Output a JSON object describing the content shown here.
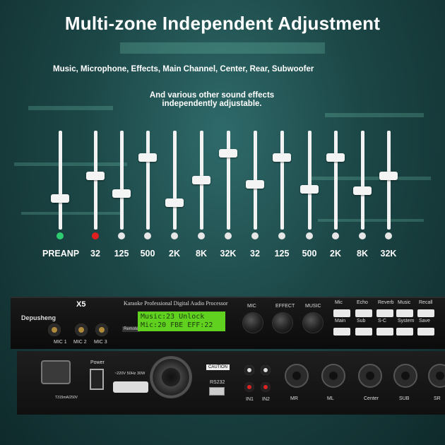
{
  "headline": "Multi-zone Independent Adjustment",
  "subtitle_line1": "Music, Microphone, Effects, Main Channel, Center, Rear, Subwoofer",
  "subtitle_line2a": "And various other sound effects",
  "subtitle_line2b": "independently adjustable.",
  "eq": {
    "bands": [
      "PREANP",
      "32",
      "125",
      "500",
      "2K",
      "8K",
      "32K",
      "32",
      "125",
      "500",
      "2K",
      "8K",
      "32K"
    ],
    "levels": [
      0.3,
      0.55,
      0.35,
      0.75,
      0.25,
      0.5,
      0.8,
      0.45,
      0.75,
      0.4,
      0.75,
      0.38,
      0.55
    ],
    "dot_colors": [
      "#2ecc71",
      "#e02020",
      "#e6e6e6",
      "#e6e6e6",
      "#e6e6e6",
      "#e6e6e6",
      "#e6e6e6",
      "#e6e6e6",
      "#e6e6e6",
      "#e6e6e6",
      "#e6e6e6",
      "#e6e6e6",
      "#e6e6e6"
    ]
  },
  "device": {
    "brand": "Depusheng",
    "model": "X5",
    "title": "Karaoke Professional Digital Audio Processor",
    "remote": "Remote",
    "lcd_line1": "Music:23    Unlock",
    "lcd_line2": "Mic:20  FBE  EFF:22",
    "mic_labels": [
      "MIC 1",
      "MIC 2",
      "MIC 3"
    ],
    "knob_labels": [
      "MIC",
      "EFFECT",
      "MUSIC"
    ],
    "buttons_row1": [
      "Mic",
      "Echo",
      "Reverb",
      "Music",
      "Recall"
    ],
    "buttons_row2": [
      "Main",
      "Sub",
      "S-C",
      "System",
      "Save"
    ],
    "rear": {
      "fuse": "T315mA/250V",
      "power": "Power",
      "voltage": "~220V 50Hz 30W",
      "caution": "CAUTION",
      "rs232": "RS232",
      "inputs": [
        "IN1",
        "IN2"
      ],
      "outputs": [
        "MR",
        "ML",
        "Center",
        "SUB",
        "SR"
      ]
    }
  }
}
